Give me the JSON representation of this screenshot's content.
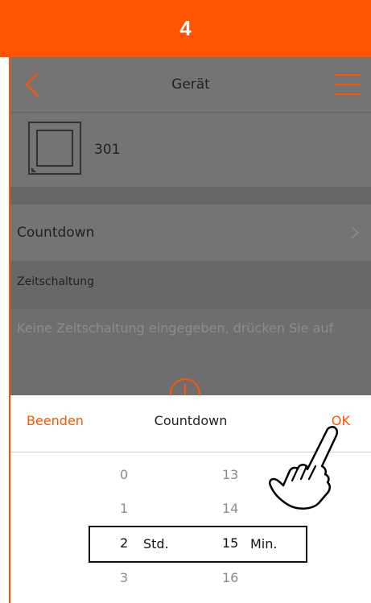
{
  "step": {
    "number": "4"
  },
  "header": {
    "title": "Gerät"
  },
  "device": {
    "name": "301"
  },
  "list": {
    "countdown_label": "Countdown"
  },
  "schedule": {
    "section_label": "Zeitschaltung",
    "empty_text": "Keine Zeitschaltung eingegeben, drücken Sie auf"
  },
  "sheet": {
    "end_label": "Beenden",
    "title": "Countdown",
    "ok_label": "OK",
    "hours": [
      "0",
      "1",
      "2",
      "3"
    ],
    "minutes": [
      "13",
      "14",
      "15",
      "16"
    ],
    "hours_unit": "Std.",
    "minutes_unit": "Min.",
    "selected_hours": "2",
    "selected_minutes": "15"
  },
  "colors": {
    "accent": "#ff5500",
    "overlay": "#6e6e6e"
  },
  "icons": {
    "back": "chevron-left-icon",
    "menu": "hamburger-menu-icon",
    "device": "switch-device-icon",
    "add": "add-circle-icon",
    "pointer": "hand-pointer-icon",
    "disclosure": "chevron-right-icon"
  }
}
